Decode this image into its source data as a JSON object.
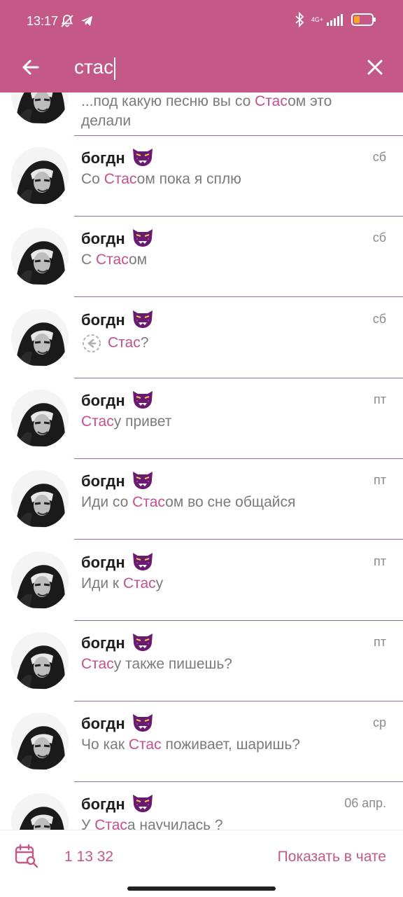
{
  "status_bar": {
    "time": "13:17",
    "network": "4G+"
  },
  "search": {
    "query": "стас",
    "placeholder": ""
  },
  "results": [
    {
      "name": "",
      "date": "",
      "pre": "...под какую песню вы со ",
      "hl": "Стас",
      "post": "ом это",
      "line2": "делали",
      "two_lines": true
    },
    {
      "name": "богдн",
      "date": "сб",
      "pre": "Со ",
      "hl": "Стас",
      "post": "ом пока я сплю"
    },
    {
      "name": "богдн",
      "date": "сб",
      "pre": "С ",
      "hl": "Стас",
      "post": "ом"
    },
    {
      "name": "богдн",
      "date": "сб",
      "pre": "",
      "hl": "Стас",
      "post": "?",
      "reply_icon": true
    },
    {
      "name": "богдн",
      "date": "пт",
      "pre": "",
      "hl": "Стас",
      "post": "у привет"
    },
    {
      "name": "богдн",
      "date": "пт",
      "pre": "Иди со ",
      "hl": "Стас",
      "post": "ом во сне общайся"
    },
    {
      "name": "богдн",
      "date": "пт",
      "pre": "Иди к ",
      "hl": "Стас",
      "post": "у"
    },
    {
      "name": "богдн",
      "date": "пт",
      "pre": "",
      "hl": "Стас",
      "post": "у также пишешь?"
    },
    {
      "name": "богдн",
      "date": "ср",
      "pre": "Чо как ",
      "hl": "Стас",
      "post": " поживает, шаришь?"
    },
    {
      "name": "богдн",
      "date": "06 апр.",
      "pre": "У ",
      "hl": "Стас",
      "post": "а научилась ?"
    }
  ],
  "bottom_bar": {
    "counter": "1 13 32",
    "show_in_chat": "Показать в чате"
  },
  "colors": {
    "accent": "#c45886",
    "highlight": "#c94e8e",
    "divider": "#9a6aa5"
  },
  "icons": {
    "back": "arrow-left-icon",
    "close": "close-icon",
    "calendar": "calendar-search-icon",
    "emoji": "panther-emoji-icon",
    "reply": "reply-icon"
  }
}
